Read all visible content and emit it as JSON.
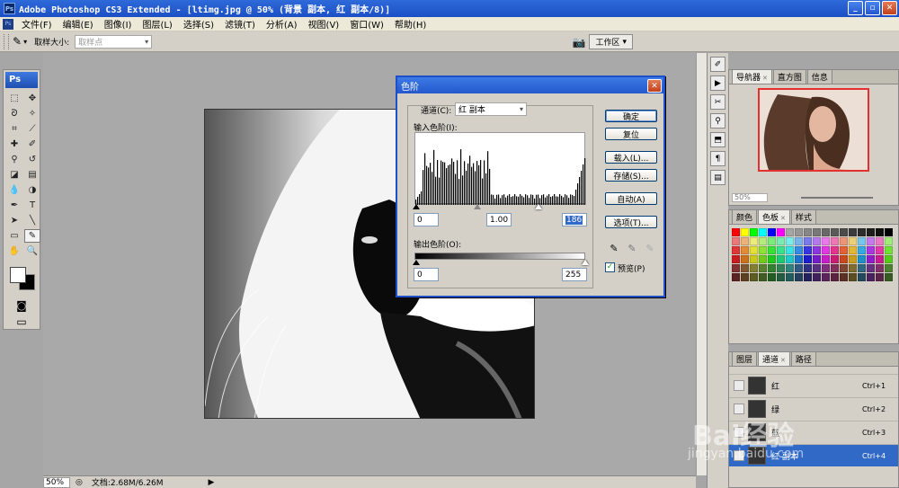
{
  "window": {
    "title": "Adobe Photoshop CS3 Extended - [ltimg.jpg @ 50% (背景 副本, 红 副本/8)]",
    "app_icon": "Ps"
  },
  "menubar": {
    "items": [
      "文件(F)",
      "编辑(E)",
      "图像(I)",
      "图层(L)",
      "选择(S)",
      "滤镜(T)",
      "分析(A)",
      "视图(V)",
      "窗口(W)",
      "帮助(H)"
    ]
  },
  "options": {
    "sample_size_label": "取样大小:",
    "sample_size_value": "取样点",
    "workspace_label": "工作区"
  },
  "toolbox": {
    "logo": "Ps"
  },
  "status": {
    "zoom": "50%",
    "doc": "文档:2.68M/6.26M"
  },
  "navigator": {
    "tabs": [
      "导航器",
      "直方图",
      "信息"
    ],
    "zoom": "50%"
  },
  "swatches_panel": {
    "tabs": [
      "颜色",
      "色板",
      "样式"
    ]
  },
  "channels_panel": {
    "tabs": [
      "图层",
      "通道",
      "路径"
    ],
    "rows": [
      {
        "name": "红",
        "shortcut": "Ctrl+1"
      },
      {
        "name": "绿",
        "shortcut": "Ctrl+2"
      },
      {
        "name": "蓝",
        "shortcut": "Ctrl+3"
      },
      {
        "name": "红 副本",
        "shortcut": "Ctrl+4"
      }
    ]
  },
  "levels": {
    "title": "色阶",
    "channel_label": "通道(C):",
    "channel_value": "红 副本",
    "input_label": "输入色阶(I):",
    "input_black": "0",
    "input_gamma": "1.00",
    "input_white": "186",
    "output_label": "输出色阶(O):",
    "output_black": "0",
    "output_white": "255",
    "buttons": {
      "ok": "确定",
      "reset": "复位",
      "load": "载入(L)...",
      "save": "存储(S)...",
      "auto": "自动(A)",
      "options": "选项(T)..."
    },
    "preview_label": "预览(P)",
    "preview_checked": true
  },
  "watermark": {
    "brand": "Bai经验",
    "url": "jingyan.baidu.com"
  },
  "colors": {
    "title_blue": "#2458cc",
    "selection": "#3169c6"
  }
}
